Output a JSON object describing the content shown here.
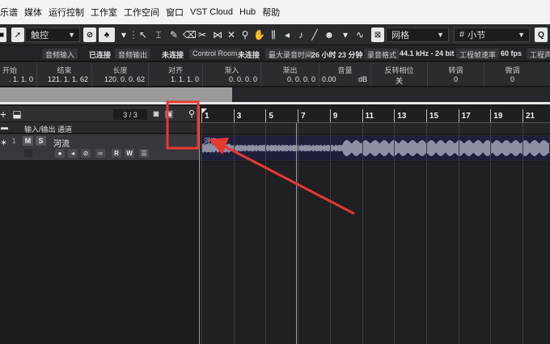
{
  "menu": {
    "items": [
      "乐谱",
      "媒体",
      "运行控制",
      "工作室",
      "工作空间",
      "窗口",
      "VST Cloud",
      "Hub",
      "帮助"
    ]
  },
  "toolbar": {
    "touch_mode": "触控",
    "grid_type": "网格",
    "quantize": "小节"
  },
  "status": {
    "audio_input_label": "音频输入",
    "audio_input_value": "已连接",
    "audio_output_label": "音频输出",
    "audio_output_value": "未连接",
    "control_room_label": "Control Room",
    "control_room_value": "未连接",
    "max_record_label": "最大录音时间",
    "max_record_value": "26 小时 23 分钟",
    "record_format_label": "录音格式",
    "record_format_value": "44.1 kHz - 24 bit",
    "frame_rate_label": "工程帧速率",
    "frame_rate_value": "60 fps",
    "project_label": "工程声"
  },
  "info": {
    "columns": [
      {
        "header": "开始",
        "value": ". 1. 1.   0"
      },
      {
        "header": "结束",
        "value": "121.  1.  1.  62"
      },
      {
        "header": "长度",
        "value": "120.  0.  0.  62"
      },
      {
        "header": "对齐",
        "value": "1.  1.  1.  0"
      },
      {
        "header": "渐入",
        "value": "0.  0.  0.  0"
      },
      {
        "header": "渐出",
        "value": "0.  0.  0.  0"
      },
      {
        "header": "音量",
        "value": "0.00",
        "unit": "dB"
      },
      {
        "header": "反转相位",
        "value": "关"
      },
      {
        "header": "转调",
        "value": "0"
      },
      {
        "header": "微调",
        "value": "0"
      }
    ]
  },
  "tracklist": {
    "count": "3 / 3",
    "folder_track_name": "输入/输出 通道",
    "audio_track_number": "1",
    "audio_track_name": "河流",
    "mute_label": "M",
    "solo_label": "S",
    "read_label": "R",
    "write_label": "W"
  },
  "ruler": {
    "bars": [
      "1",
      "3",
      "5",
      "7",
      "9",
      "11",
      "13",
      "15",
      "17",
      "19",
      "21"
    ]
  },
  "clip": {
    "name": "河流"
  },
  "annotation": {
    "color": "#e8392f"
  }
}
